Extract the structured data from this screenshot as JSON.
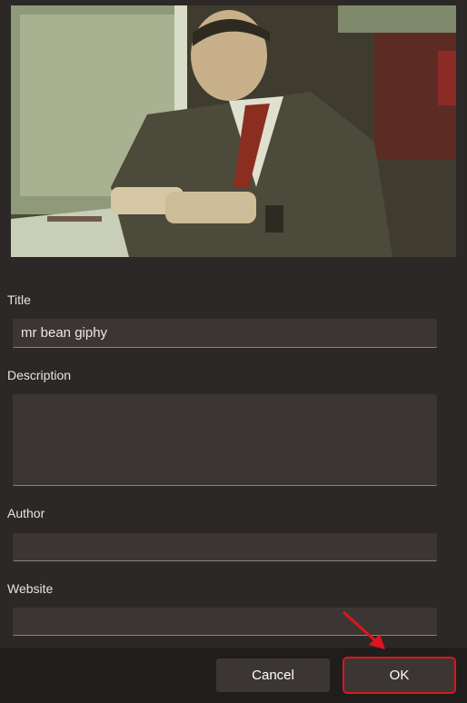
{
  "form": {
    "title_label": "Title",
    "title_value": "mr bean giphy",
    "description_label": "Description",
    "description_value": "",
    "author_label": "Author",
    "author_value": "",
    "website_label": "Website",
    "website_value": ""
  },
  "buttons": {
    "cancel_label": "Cancel",
    "ok_label": "OK"
  },
  "colors": {
    "background": "#2b2827",
    "field": "#3b3634",
    "footer": "#201d1d",
    "highlight": "#e0141c"
  }
}
